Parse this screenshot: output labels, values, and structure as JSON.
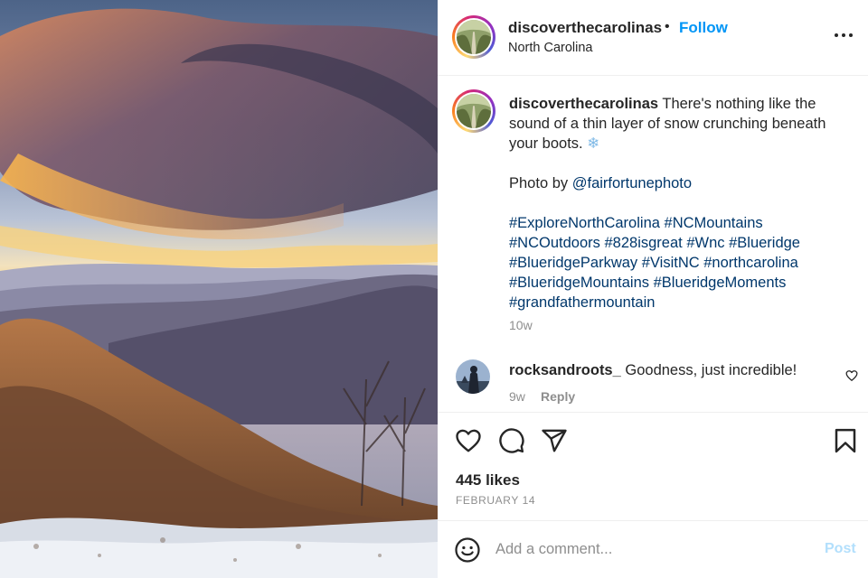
{
  "post": {
    "photo_alt": "",
    "header": {
      "username": "discoverthecarolinas",
      "separator": "•",
      "follow_label": "Follow",
      "location": "North Carolina",
      "more_icon": "more-horizontal-icon"
    },
    "caption": {
      "username": "discoverthecarolinas",
      "text": "There's nothing like the sound of a thin layer of snow crunching beneath your boots.",
      "emoji": "❄",
      "photo_credit_prefix": "Photo by",
      "photo_credit_handle": "@fairfortunephoto",
      "hashtags": [
        "#ExploreNorthCarolina",
        "#NCMountains",
        "#NCOutdoors",
        "#828isgreat",
        "#Wnc",
        "#Blueridge",
        "#BlueridgeParkway",
        "#VisitNC",
        "#northcarolina",
        "#BlueridgeMountains",
        "#BlueridgeMoments",
        "#grandfathermountain"
      ],
      "time": "10w"
    },
    "comments": [
      {
        "username": "rocksandroots_",
        "text": "Goodness, just incredible!",
        "time": "9w",
        "reply_label": "Reply"
      }
    ],
    "actions": {
      "like_icon": "heart-icon",
      "comment_icon": "comment-icon",
      "share_icon": "share-icon",
      "save_icon": "bookmark-icon"
    },
    "likes": "445 likes",
    "date": "FEBRUARY 14",
    "add_comment": {
      "placeholder": "Add a comment...",
      "post_label": "Post",
      "emoji_icon": "emoji-icon"
    },
    "colors": {
      "accent": "#0095f6",
      "link": "#00376b",
      "muted": "#8e8e8e",
      "post_disabled": "#b2dffc"
    }
  }
}
